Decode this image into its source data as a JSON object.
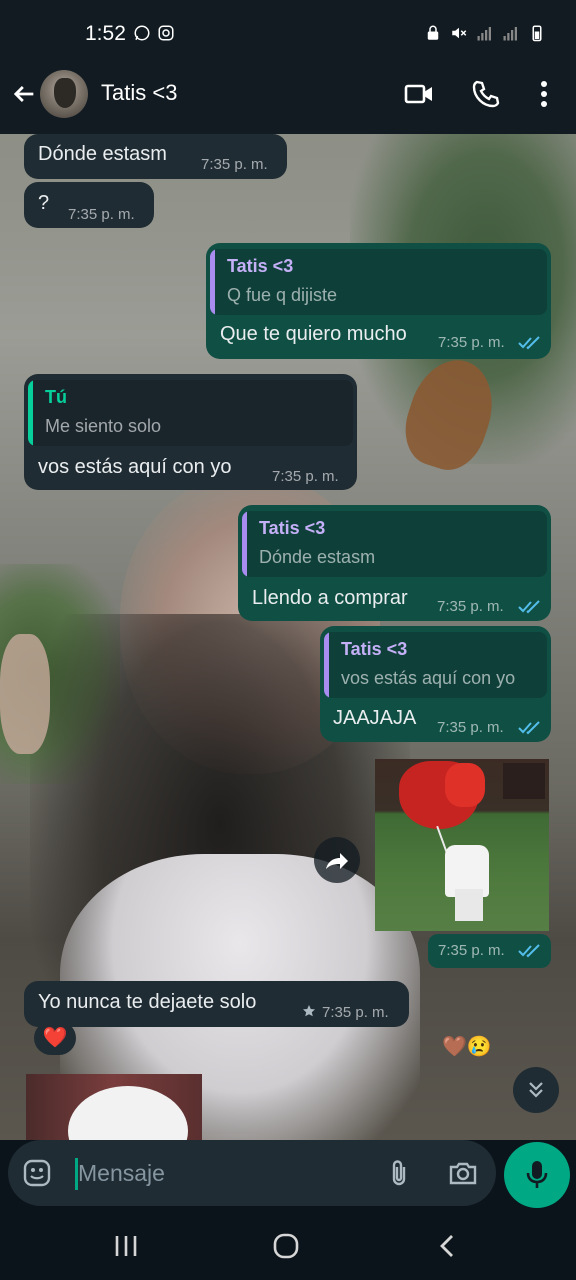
{
  "status_bar": {
    "time": "1:52"
  },
  "header": {
    "contact_name": "Tatis <3"
  },
  "messages": [
    {
      "text": "Dónde estasm",
      "time": "7:35 p. m."
    },
    {
      "text": "?",
      "time": "7:35 p. m."
    },
    {
      "quote_name": "Tatis <3",
      "quote_text": "Q fue q dijiste",
      "text": "Que te quiero mucho",
      "time": "7:35 p. m."
    },
    {
      "quote_name": "Tú",
      "quote_text": "Me siento solo",
      "text": "vos estás aquí con yo",
      "time": "7:35 p. m."
    },
    {
      "quote_name": "Tatis <3",
      "quote_text": "Dónde estasm",
      "text": "Llendo a comprar",
      "time": "7:35 p. m."
    },
    {
      "quote_name": "Tatis <3",
      "quote_text": "vos estás aquí con yo",
      "text": "JAAJAJA",
      "time": "7:35 p. m."
    },
    {
      "text": "",
      "time": "7:35 p. m."
    },
    {
      "text": "Yo nunca te dejaete solo",
      "time": "7:35 p. m."
    }
  ],
  "reactions": {
    "left": "❤️",
    "right": "🤎😢"
  },
  "composer": {
    "placeholder": "Mensaje"
  },
  "colors": {
    "accent": "#00a884",
    "read_ticks": "#53bdeb"
  }
}
